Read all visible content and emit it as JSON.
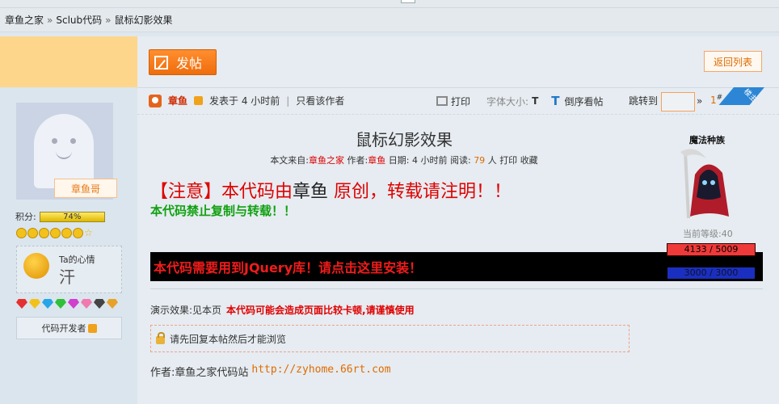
{
  "breadcrumb": {
    "items": [
      "章鱼之家",
      "Sclub代码",
      "鼠标幻影效果"
    ],
    "separator": "»"
  },
  "toolbar": {
    "post_label": "发帖",
    "back_label": "返回列表"
  },
  "author_panel": {
    "username": "章鱼哥",
    "score_label": "积分:",
    "score_percent": "74%",
    "mood_title": "Ta的心情",
    "mood_text": "汗",
    "dev_label": "代码开发者"
  },
  "post_header": {
    "author": "章鱼",
    "posted": "发表于  4 小时前",
    "author_only": "只看该作者",
    "print": "打印",
    "font_size_label": "字体大小:",
    "font_small": "T",
    "font_large": "T",
    "reverse": "倒序看帖",
    "jump_label": "跳转到",
    "jump_arrow": "»",
    "floor_num": "1",
    "floor_sup": "#",
    "corner_label": "楼主"
  },
  "post": {
    "title": "鼠标幻影效果",
    "meta": {
      "source_label": "本文来自:",
      "source": "章鱼之家",
      "author_label": "作者:",
      "author": "章鱼",
      "date_label": "日期:",
      "date": "4 小时前",
      "reads_label": "阅读:",
      "reads": "79",
      "reads_unit": "人",
      "print": "打印",
      "favorite": "收藏"
    },
    "notice_a": "【注意】本代码由",
    "notice_b": "章鱼",
    "notice_c": " 原创，转载请注明！！",
    "no_copy": "本代码禁止复制与转载！！",
    "jquery_notice": "本代码需要用到JQuery库！请点击这里安装！",
    "demo_label": "演示效果:见本页",
    "demo_warning": "本代码可能会造成页面比较卡顿,请谨慎使用",
    "locked_text": "请先回复本帖然后才能浏览",
    "author_line_label": "作者:章鱼之家代码站",
    "author_line_url": "http://zyhome.66rt.com"
  },
  "rpg": {
    "role": "魔法种族",
    "level": "当前等级:40",
    "hp": "4133 / 5009",
    "mp": "3000 / 3000"
  },
  "colors": {
    "accent_orange": "#ef6d0c",
    "notice_red": "#e00000",
    "green": "#12a012",
    "page_bg": "#e6ecf1"
  }
}
